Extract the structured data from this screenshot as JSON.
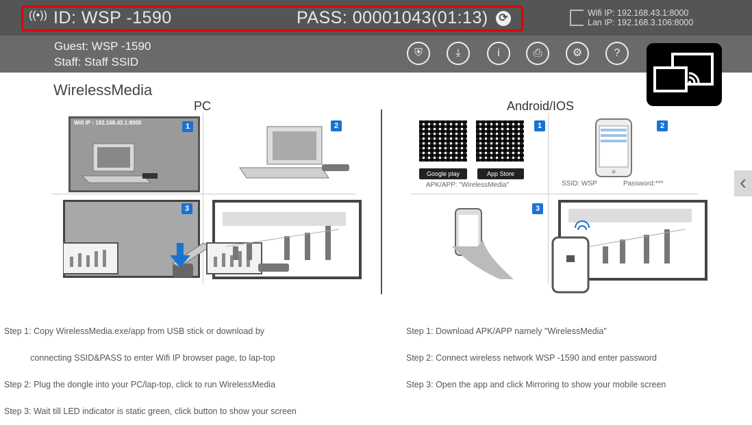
{
  "header": {
    "id_label": "ID: WSP -1590",
    "pass_label": "PASS: 00001043(01:13)",
    "wifi_ip": "Wifi IP: 192.168.43.1:8000",
    "lan_ip": "Lan IP: 192.168.3.106:8000"
  },
  "subheader": {
    "guest": "Guest: WSP -1590",
    "staff": "Staff: Staff SSID"
  },
  "toolbar": {
    "icons": [
      "shield-icon",
      "download-icon",
      "info-icon",
      "printer-icon",
      "settings-icon",
      "help-icon"
    ]
  },
  "main": {
    "app_title": "WirelessMedia",
    "pc_title": "PC",
    "mobile_title": "Android/IOS",
    "pc_screen_label": "Wifi IP : 192.168.43.1:8000",
    "badges": [
      "1",
      "2",
      "3"
    ],
    "apk_caption": "APK/APP: \"WirelessMedia\"",
    "google_play": "Google play",
    "app_store": "App Store",
    "ssid_caption": "SSID: WSP",
    "password_caption": "Password:***"
  },
  "pc_steps": [
    "Step 1: Copy WirelessMedia.exe/app from USB stick or download by",
    "           connecting SSID&PASS to enter Wifi IP browser page, to lap-top",
    "Step 2: Plug the dongle into your PC/lap-top, click to run WirelessMedia",
    "Step 3: Wait till LED indicator is static green, click button to show your screen"
  ],
  "mobile_steps": [
    "Step 1: Download APK/APP namely \"WirelessMedia\"",
    "Step 2: Connect wireless network WSP -1590 and enter password",
    "Step 3: Open the app and click Mirroring to show your mobile screen"
  ]
}
